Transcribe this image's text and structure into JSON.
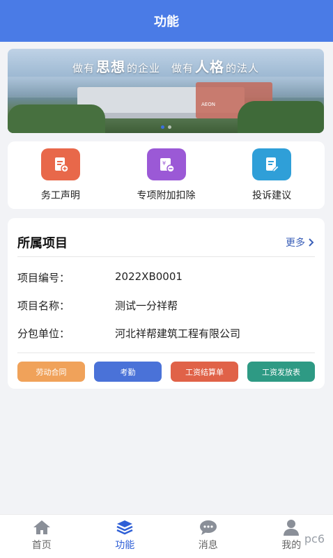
{
  "header": {
    "title": "功能"
  },
  "banner": {
    "slogan_a": "做有",
    "slogan_b": "思想",
    "slogan_c": "的企业　做有",
    "slogan_d": "人格",
    "slogan_e": "的法人",
    "sign": "AEON",
    "slides": 2,
    "active_slide": 1
  },
  "quick": [
    {
      "label": "务工声明",
      "icon": "document-add-icon",
      "color": "#e8684a"
    },
    {
      "label": "专项附加扣除",
      "icon": "yuan-receipt-icon",
      "color": "#9b59d6"
    },
    {
      "label": "投诉建议",
      "icon": "edit-document-icon",
      "color": "#2f9fd8"
    }
  ],
  "project": {
    "title": "所属项目",
    "more": "更多",
    "fields": [
      {
        "key": "项目编号：",
        "value": "2022XB0001"
      },
      {
        "key": "项目名称：",
        "value": "测试一分祥帮"
      },
      {
        "key": "分包单位：",
        "value": "河北祥帮建筑工程有限公司"
      }
    ],
    "actions": [
      {
        "label": "劳动合同",
        "color": "#f0a25a"
      },
      {
        "label": "考勤",
        "color": "#4a72d8"
      },
      {
        "label": "工资结算单",
        "color": "#e06248"
      },
      {
        "label": "工资发放表",
        "color": "#2e9a84"
      }
    ]
  },
  "tabbar": [
    {
      "label": "首页",
      "icon": "home-icon"
    },
    {
      "label": "功能",
      "icon": "layers-icon",
      "active": true
    },
    {
      "label": "消息",
      "icon": "chat-icon"
    },
    {
      "label": "我的",
      "icon": "user-icon"
    }
  ],
  "watermark": "pc6"
}
